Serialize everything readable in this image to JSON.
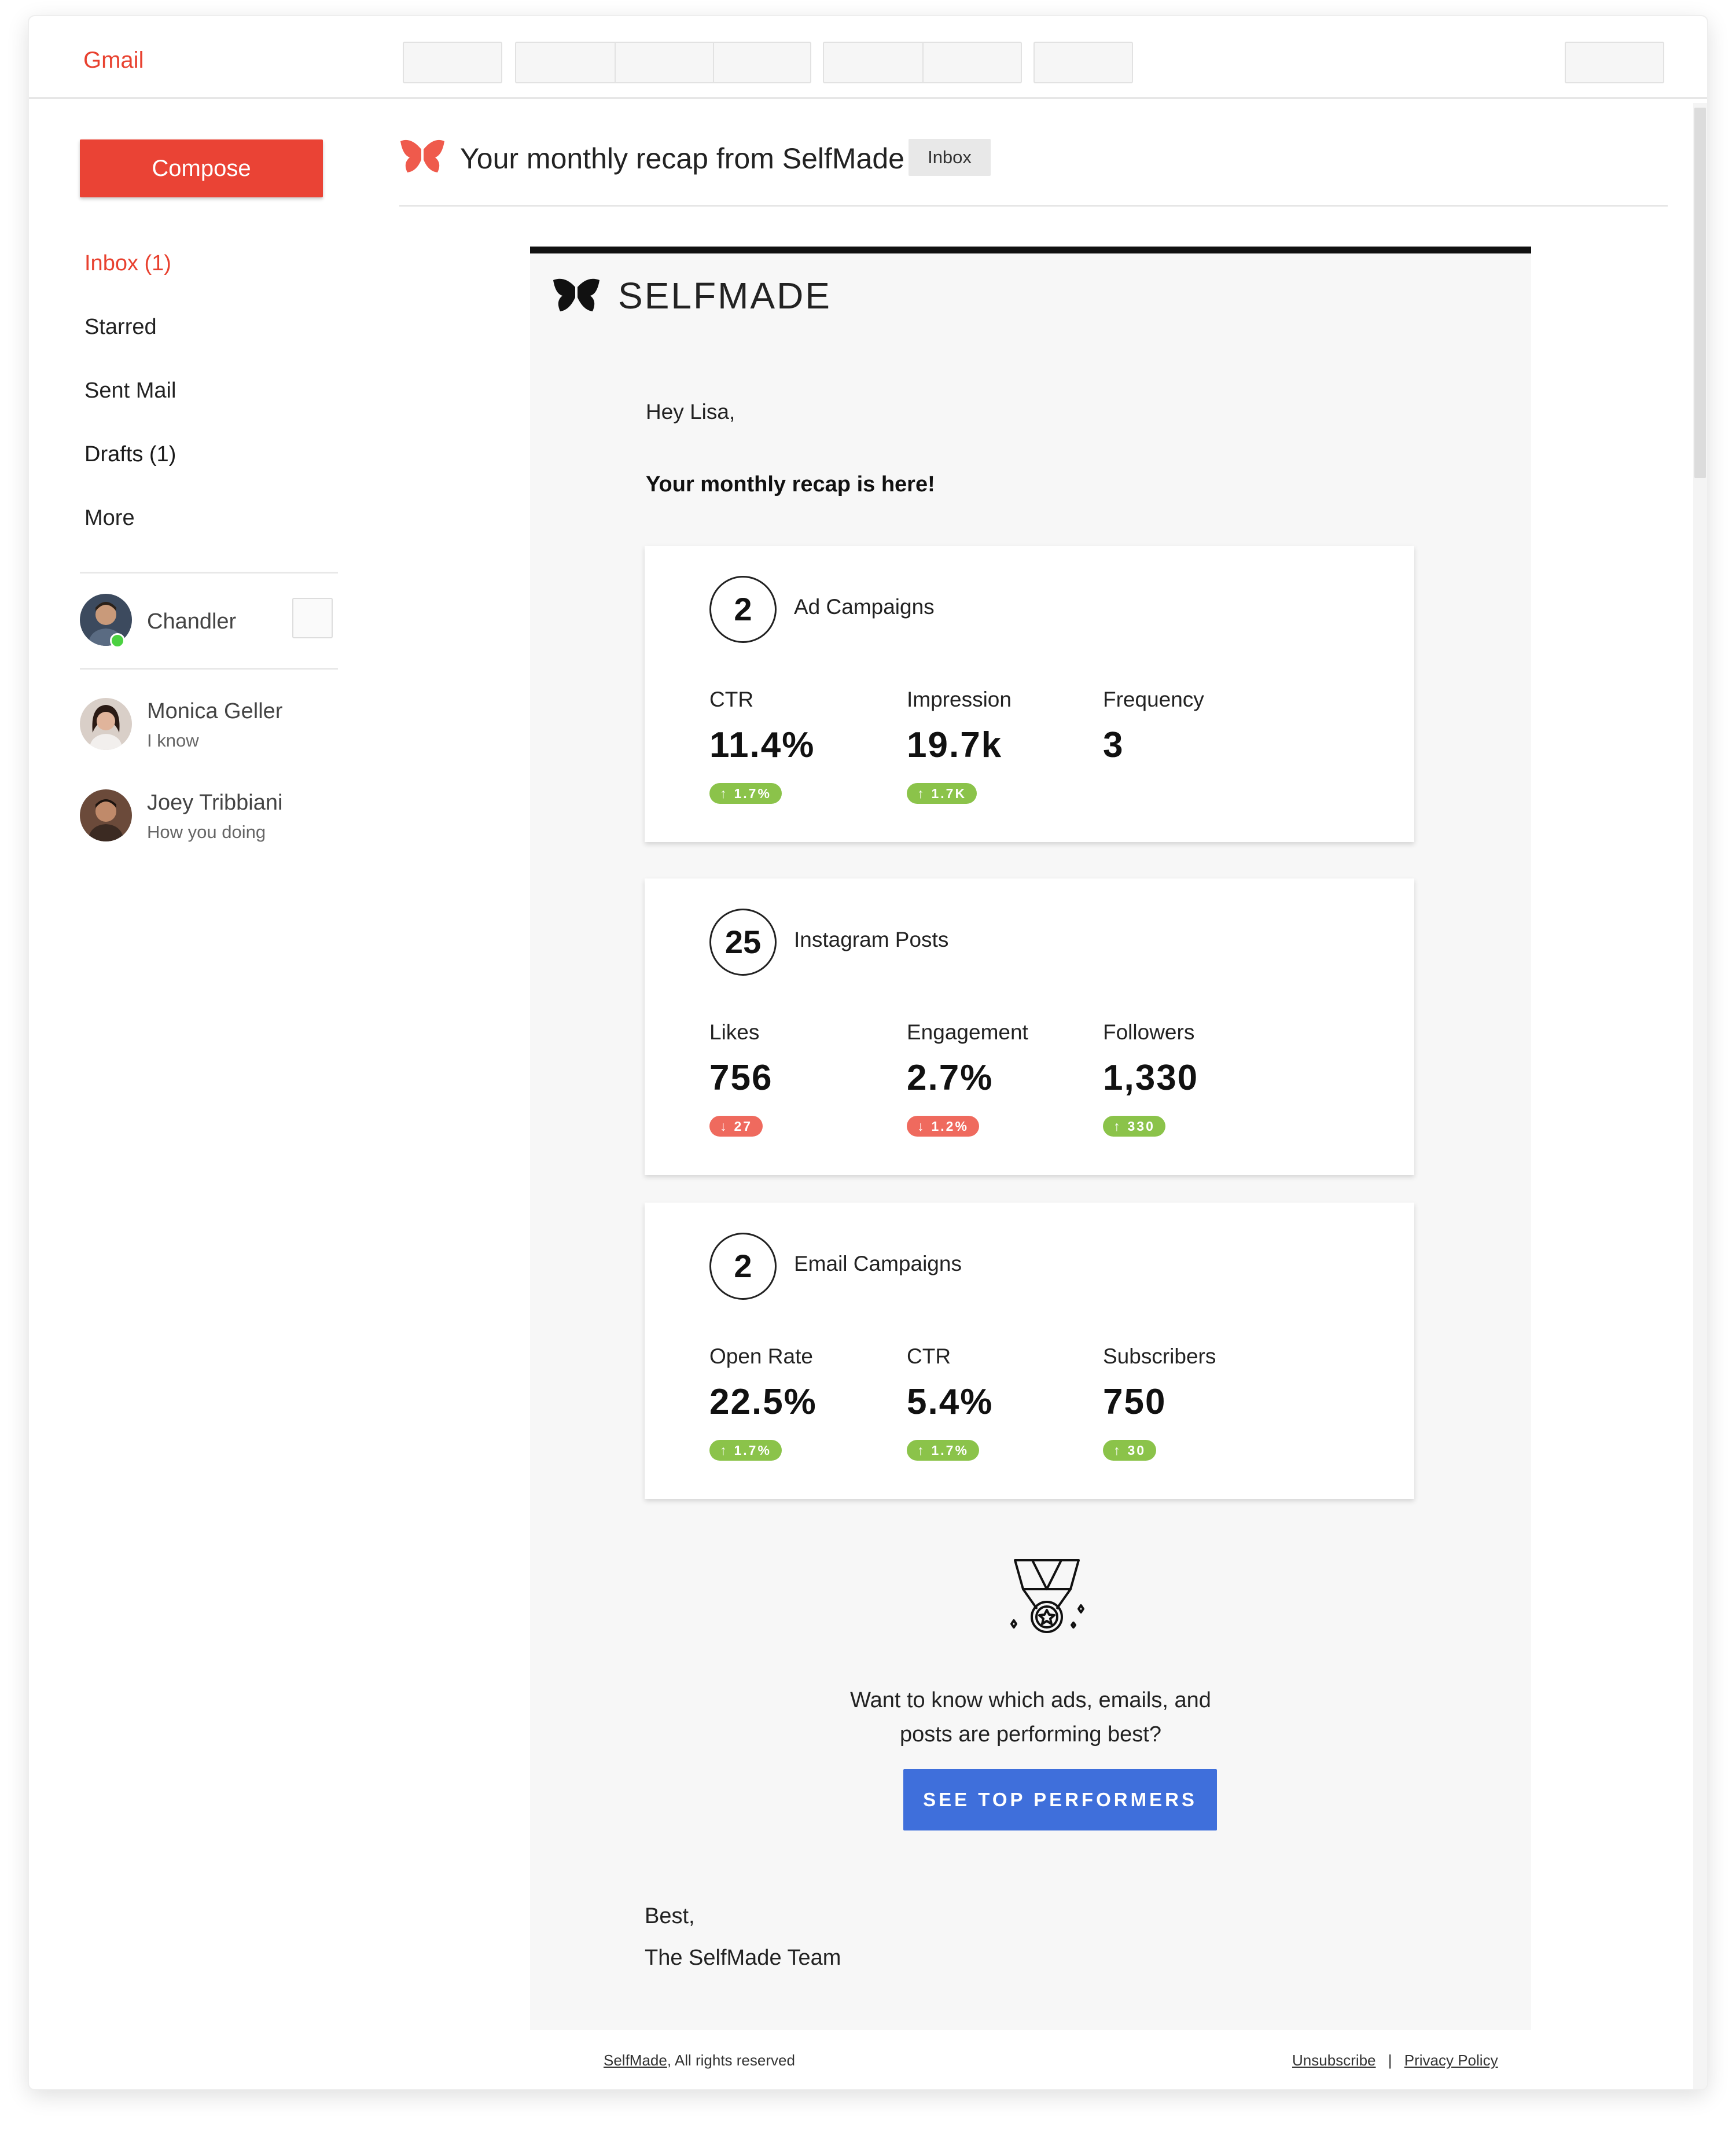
{
  "app": {
    "name": "Gmail"
  },
  "sidebar": {
    "compose_label": "Compose",
    "items": [
      {
        "label": "Inbox (1)"
      },
      {
        "label": "Starred"
      },
      {
        "label": "Sent Mail"
      },
      {
        "label": "Drafts (1)"
      },
      {
        "label": "More"
      }
    ],
    "contacts": [
      {
        "name": "Chandler",
        "status": "",
        "online": true
      },
      {
        "name": "Monica Geller",
        "status": "I know"
      },
      {
        "name": "Joey Tribbiani",
        "status": "How you doing"
      }
    ]
  },
  "message": {
    "subject": "Your monthly recap from SelfMade",
    "label": "Inbox"
  },
  "email": {
    "brand": "SELFMADE",
    "greeting": "Hey Lisa,",
    "lede": "Your monthly recap is here!",
    "cards": [
      {
        "count": "2",
        "title": "Ad Campaigns",
        "metrics": [
          {
            "label": "CTR",
            "value": "11.4%",
            "delta": "1.7%",
            "direction": "up"
          },
          {
            "label": "Impression",
            "value": "19.7k",
            "delta": "1.7K",
            "direction": "up"
          },
          {
            "label": "Frequency",
            "value": "3"
          }
        ]
      },
      {
        "count": "25",
        "title": "Instagram Posts",
        "metrics": [
          {
            "label": "Likes",
            "value": "756",
            "delta": "27",
            "direction": "down"
          },
          {
            "label": "Engagement",
            "value": "2.7%",
            "delta": "1.2%",
            "direction": "down"
          },
          {
            "label": "Followers",
            "value": "1,330",
            "delta": "330",
            "direction": "up"
          }
        ]
      },
      {
        "count": "2",
        "title": "Email Campaigns",
        "metrics": [
          {
            "label": "Open Rate",
            "value": "22.5%",
            "delta": "1.7%",
            "direction": "up"
          },
          {
            "label": "CTR",
            "value": "5.4%",
            "delta": "1.7%",
            "direction": "up"
          },
          {
            "label": "Subscribers",
            "value": "750",
            "delta": "30",
            "direction": "up"
          }
        ]
      }
    ],
    "cta": {
      "line1": "Want to know which ads, emails, and",
      "line2": "posts are performing best?",
      "button": "SEE TOP PERFORMERS"
    },
    "signoff": {
      "line1": "Best,",
      "line2": "The SelfMade Team"
    },
    "footer": {
      "company_link": "SelfMade",
      "rights": ", All rights reserved",
      "unsubscribe": "Unsubscribe",
      "separator": "|",
      "privacy": "Privacy Policy"
    }
  },
  "colors": {
    "gmail_red": "#ea4335",
    "up": "#8bc34a",
    "down": "#ef6a5e",
    "cta_blue": "#3f6fdb"
  },
  "icons": [
    "butterfly-icon",
    "medal-icon",
    "arrow-up-icon",
    "arrow-down-icon",
    "online-indicator"
  ]
}
